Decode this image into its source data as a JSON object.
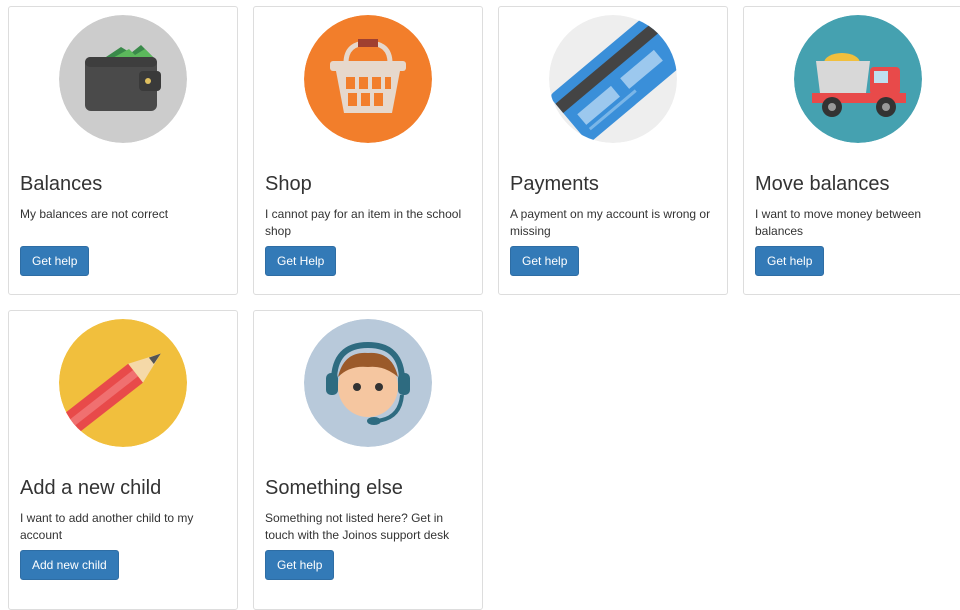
{
  "cards": [
    {
      "title": "Balances",
      "text": "My balances are not correct",
      "button": "Get help",
      "icon": "wallet-icon",
      "circle": "#cccccc"
    },
    {
      "title": "Shop",
      "text": "I cannot pay for an item in the school shop",
      "button": "Get Help",
      "icon": "shopping-basket-icon",
      "circle": "#f27e2b"
    },
    {
      "title": "Payments",
      "text": "A payment on my account is wrong or missing",
      "button": "Get help",
      "icon": "credit-card-icon",
      "circle": "#eeeeee"
    },
    {
      "title": "Move balances",
      "text": "I want to move money between balances",
      "button": "Get help",
      "icon": "truck-icon",
      "circle": "#45a1b0"
    },
    {
      "title": "Add a new child",
      "text": "I want to add another child to my account",
      "button": "Add new child",
      "icon": "pencil-icon",
      "circle": "#f1bf3d"
    },
    {
      "title": "Something else",
      "text": "Something not listed here? Get in touch with the Joinos support desk",
      "button": "Get help",
      "icon": "support-agent-icon",
      "circle": "#b8c9da"
    }
  ],
  "colors": {
    "button": "#337ab7",
    "border": "#dddddd",
    "text": "#333333"
  }
}
